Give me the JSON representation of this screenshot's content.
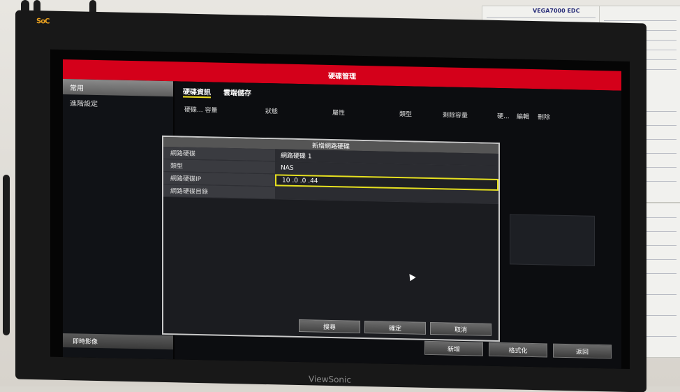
{
  "brand": "ViewSonic",
  "logo": "SoC",
  "window": {
    "title": "硬碟管理"
  },
  "sidebar": {
    "items": [
      {
        "label": "常用",
        "active": true
      },
      {
        "label": "進階設定",
        "active": false
      }
    ],
    "bottom_label": "即時影像"
  },
  "tabs": [
    {
      "label": "硬碟資訊",
      "active": true
    },
    {
      "label": "雲端儲存",
      "active": false
    }
  ],
  "columns": [
    "硬碟... 容量",
    "狀態",
    "屬性",
    "類型",
    "剩餘容量",
    "硬...",
    "編輯",
    "刪除"
  ],
  "main_buttons": [
    "新增",
    "格式化",
    "返回"
  ],
  "dialog": {
    "title": "新增網路硬碟",
    "fields": [
      {
        "label": "網路硬碟",
        "value": "網路硬碟 1"
      },
      {
        "label": "類型",
        "value": "NAS"
      },
      {
        "label": "網路硬碟IP",
        "value": "10 .0 .0 .44"
      },
      {
        "label": "網路硬碟目錄",
        "value": ""
      }
    ],
    "buttons": [
      "搜尋",
      "確定",
      "取消"
    ]
  },
  "colors": {
    "title_bar": "#d4001a",
    "highlight": "#e6e020"
  },
  "paper": {
    "header_text": "VEGA7000 EDC"
  }
}
